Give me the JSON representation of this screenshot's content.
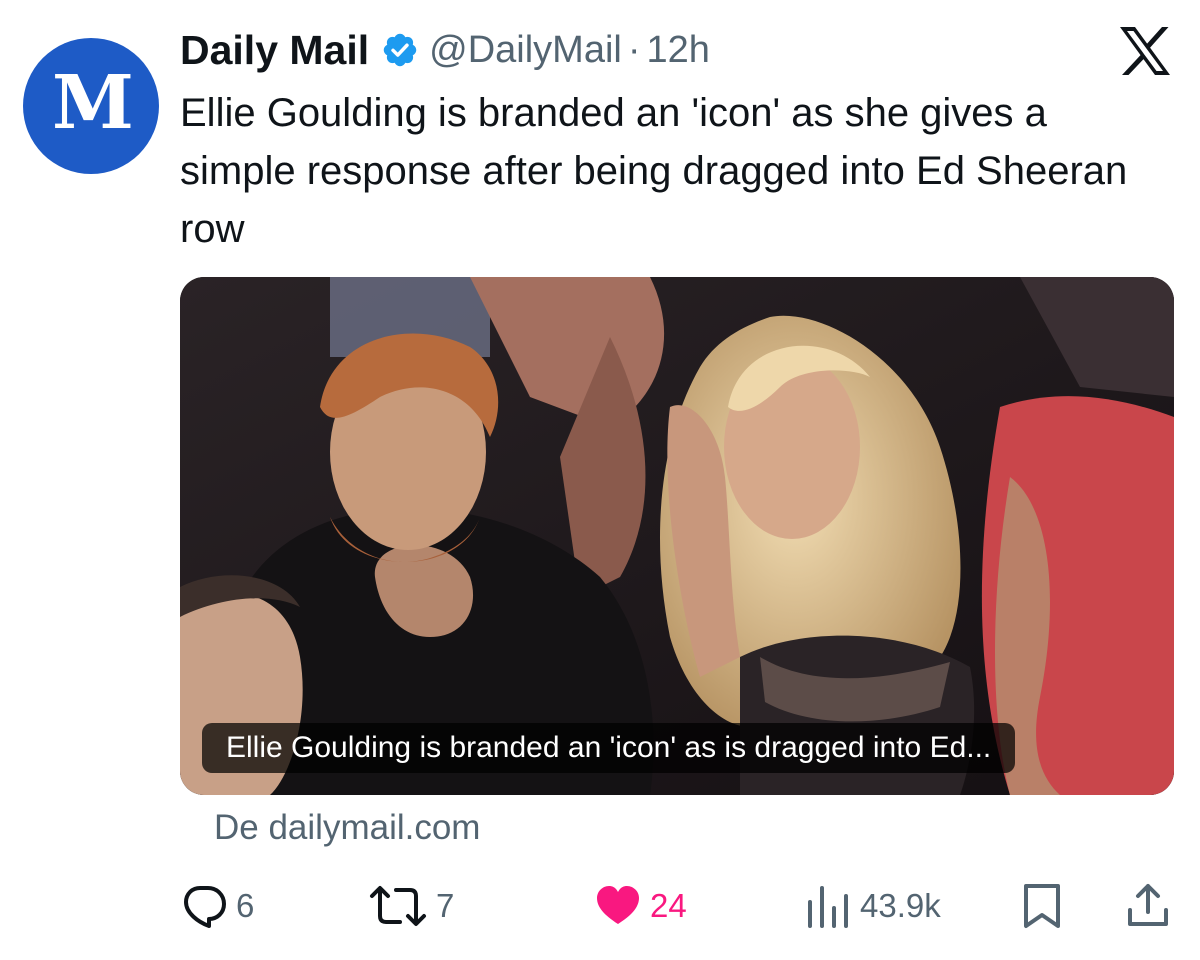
{
  "account": {
    "avatar_letter": "M",
    "display_name": "Daily Mail",
    "handle": "@DailyMail",
    "separator": "·",
    "time": "12h"
  },
  "tweet": {
    "text": "Ellie Goulding is branded an 'icon' as she gives a simple response after being dragged into Ed Sheeran row"
  },
  "card": {
    "caption": "Ellie Goulding is branded an 'icon' as is dragged into Ed...",
    "source": "De dailymail.com"
  },
  "actions": {
    "replies": "6",
    "reposts": "7",
    "likes": "24",
    "views": "43.9k"
  },
  "icons": {
    "verified": "verified-badge-icon",
    "platform": "x-logo-icon",
    "reply": "reply-icon",
    "repost": "repost-icon",
    "like": "heart-icon",
    "views": "views-icon",
    "bookmark": "bookmark-icon",
    "share": "share-icon"
  },
  "colors": {
    "brand_blue": "#1e5bc6",
    "verified_blue": "#1d9bf0",
    "like_pink": "#f91880",
    "muted": "#536471"
  }
}
